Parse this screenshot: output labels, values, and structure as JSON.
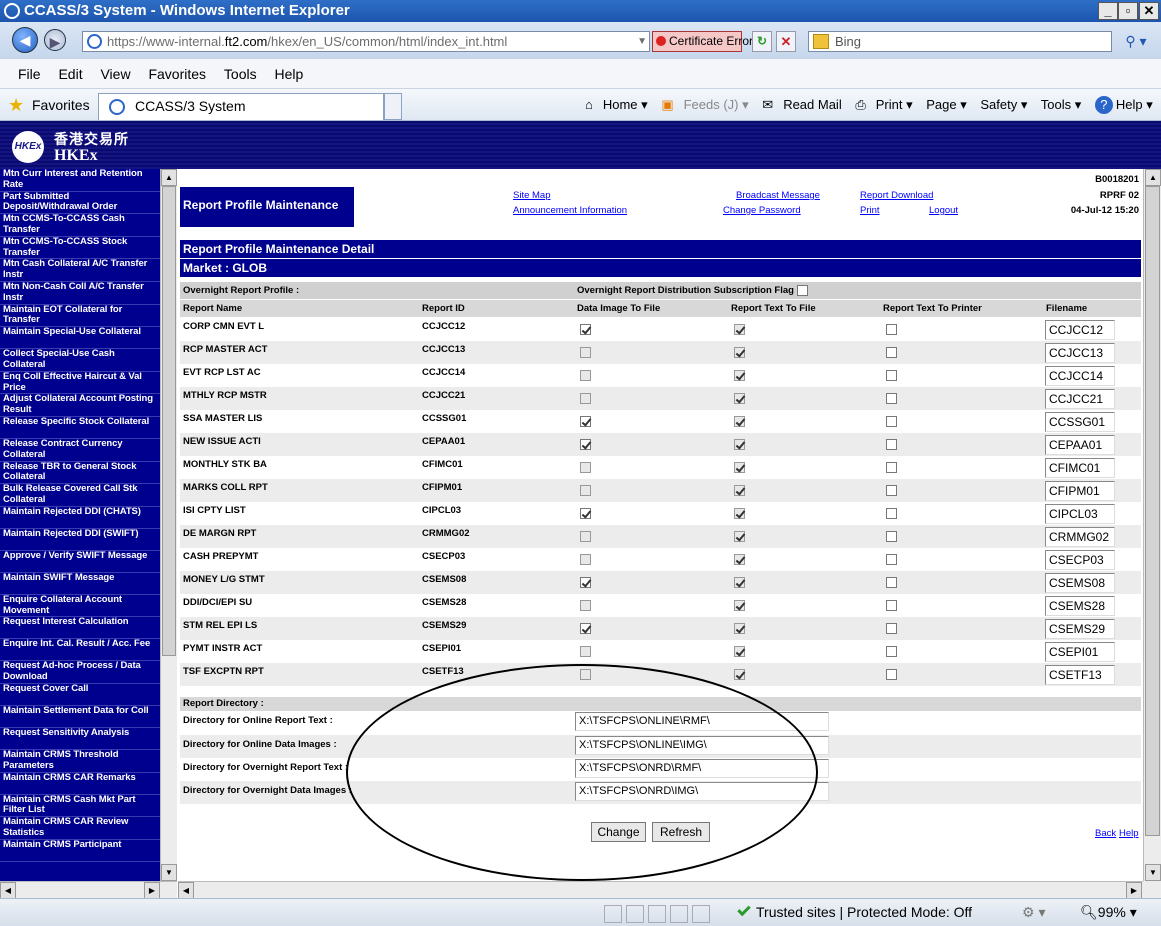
{
  "window": {
    "title": "CCASS/3 System - Windows Internet Explorer"
  },
  "address": {
    "url_prefix": "https://www-internal.",
    "url_domain": "ft2.com",
    "url_suffix": "/hkex/en_US/common/html/index_int.html",
    "cert_error": "Certificate Error",
    "search_placeholder": "Bing"
  },
  "menu": [
    "File",
    "Edit",
    "View",
    "Favorites",
    "Tools",
    "Help"
  ],
  "favorites": {
    "label": "Favorites",
    "tab": "CCASS/3 System",
    "commands": [
      "Home ▾",
      "Feeds (J) ▾",
      "Read Mail",
      "Print ▾",
      "Page ▾",
      "Safety ▾",
      "Tools ▾",
      "Help ▾"
    ]
  },
  "logo": {
    "cn": "香港交易所",
    "en": "HKEx"
  },
  "sidebar": {
    "items": [
      "Mtn Curr Interest and Retention Rate",
      "Part Submitted Deposit/Withdrawal Order",
      "Mtn CCMS-To-CCASS Cash Transfer",
      "Mtn CCMS-To-CCASS Stock Transfer",
      "Mtn Cash Collateral A/C Transfer Instr",
      "Mtn Non-Cash Coll A/C Transfer Instr",
      "Maintain EOT Collateral for Transfer",
      "Maintain Special-Use Collateral",
      "Collect Special-Use Cash Collateral",
      "Enq Coll Effective Haircut & Val Price",
      "Adjust Collateral Account Posting Result",
      "Release Specific Stock Collateral",
      "Release Contract Currency Collateral",
      "Release TBR to General Stock Collateral",
      "Bulk Release Covered Call Stk Collateral",
      "Maintain Rejected DDI (CHATS)",
      "Maintain Rejected DDI (SWIFT)",
      "Approve / Verify SWIFT Message",
      "Maintain SWIFT Message",
      "Enquire Collateral Account Movement",
      "Request Interest Calculation",
      "Enquire Int. Cal. Result / Acc. Fee",
      "Request Ad-hoc Process / Data Download",
      "Request Cover Call",
      "Maintain Settlement Data for Coll",
      "Request Sensitivity Analysis",
      "Maintain CRMS Threshold Parameters",
      "Maintain CRMS CAR Remarks",
      "Maintain CRMS Cash Mkt Part Filter List",
      "Maintain CRMS CAR Review Statistics",
      "Maintain CRMS Participant"
    ]
  },
  "header": {
    "title": "Report Profile Maintenance",
    "links": [
      "Site Map",
      "Broadcast Message",
      "Report Download",
      "Announcement Information",
      "Change Password",
      "Print",
      "Logout"
    ],
    "user_id": "B0018201",
    "screen_id": "RPRF 02",
    "datetime": "04-Jul-12 15:20"
  },
  "detail": {
    "title": "Report Profile Maintenance Detail",
    "market": "Market : GLOB",
    "overnight_profile": "Overnight Report Profile :",
    "subscription_flag": "Overnight Report Distribution Subscription Flag",
    "columns": [
      "Report Name",
      "Report ID",
      "Data Image To File",
      "Report Text To File",
      "Report Text To Printer",
      "Filename"
    ],
    "rows": [
      {
        "name": "CORP CMN EVT L",
        "id": "CCJCC12",
        "img": true,
        "text": true,
        "printer": false,
        "filename": "CCJCC12"
      },
      {
        "name": "RCP MASTER ACT",
        "id": "CCJCC13",
        "img": false,
        "text": true,
        "printer": false,
        "filename": "CCJCC13"
      },
      {
        "name": "EVT RCP LST AC",
        "id": "CCJCC14",
        "img": false,
        "text": true,
        "printer": false,
        "filename": "CCJCC14"
      },
      {
        "name": "MTHLY RCP MSTR",
        "id": "CCJCC21",
        "img": false,
        "text": true,
        "printer": false,
        "filename": "CCJCC21"
      },
      {
        "name": "SSA MASTER LIS",
        "id": "CCSSG01",
        "img": true,
        "text": true,
        "printer": false,
        "filename": "CCSSG01"
      },
      {
        "name": "NEW ISSUE ACTI",
        "id": "CEPAA01",
        "img": true,
        "text": true,
        "printer": false,
        "filename": "CEPAA01"
      },
      {
        "name": "MONTHLY STK BA",
        "id": "CFIMC01",
        "img": false,
        "text": true,
        "printer": false,
        "filename": "CFIMC01"
      },
      {
        "name": "MARKS COLL RPT",
        "id": "CFIPM01",
        "img": false,
        "text": true,
        "printer": false,
        "filename": "CFIPM01"
      },
      {
        "name": "ISI CPTY LIST",
        "id": "CIPCL03",
        "img": true,
        "text": true,
        "printer": false,
        "filename": "CIPCL03"
      },
      {
        "name": "DE MARGN RPT",
        "id": "CRMMG02",
        "img": false,
        "text": true,
        "printer": false,
        "filename": "CRMMG02"
      },
      {
        "name": "CASH PREPYMT",
        "id": "CSECP03",
        "img": false,
        "text": true,
        "printer": false,
        "filename": "CSECP03"
      },
      {
        "name": "MONEY L/G STMT",
        "id": "CSEMS08",
        "img": true,
        "text": true,
        "printer": false,
        "filename": "CSEMS08"
      },
      {
        "name": "DDI/DCI/EPI SU",
        "id": "CSEMS28",
        "img": false,
        "text": true,
        "printer": false,
        "filename": "CSEMS28"
      },
      {
        "name": "STM REL EPI LS",
        "id": "CSEMS29",
        "img": true,
        "text": true,
        "printer": false,
        "filename": "CSEMS29"
      },
      {
        "name": "PYMT INSTR ACT",
        "id": "CSEPI01",
        "img": false,
        "text": true,
        "printer": false,
        "filename": "CSEPI01"
      },
      {
        "name": "TSF EXCPTN RPT",
        "id": "CSETF13",
        "img": false,
        "text": true,
        "printer": false,
        "filename": "CSETF13"
      }
    ]
  },
  "directory": {
    "title": "Report Directory :",
    "rows": [
      {
        "label": "Directory for Online Report Text :",
        "value": "X:\\TSFCPS\\ONLINE\\RMF\\"
      },
      {
        "label": "Directory for Online Data Images :",
        "value": "X:\\TSFCPS\\ONLINE\\IMG\\"
      },
      {
        "label": "Directory for Overnight Report Text :",
        "value": "X:\\TSFCPS\\ONRD\\RMF\\"
      },
      {
        "label": "Directory for Overnight Data Images :",
        "value": "X:\\TSFCPS\\ONRD\\IMG\\"
      }
    ]
  },
  "buttons": {
    "change": "Change",
    "refresh": "Refresh",
    "back": "Back",
    "help": "Help"
  },
  "status": {
    "zone": "Trusted sites | Protected Mode: Off",
    "zoom": "99%"
  }
}
